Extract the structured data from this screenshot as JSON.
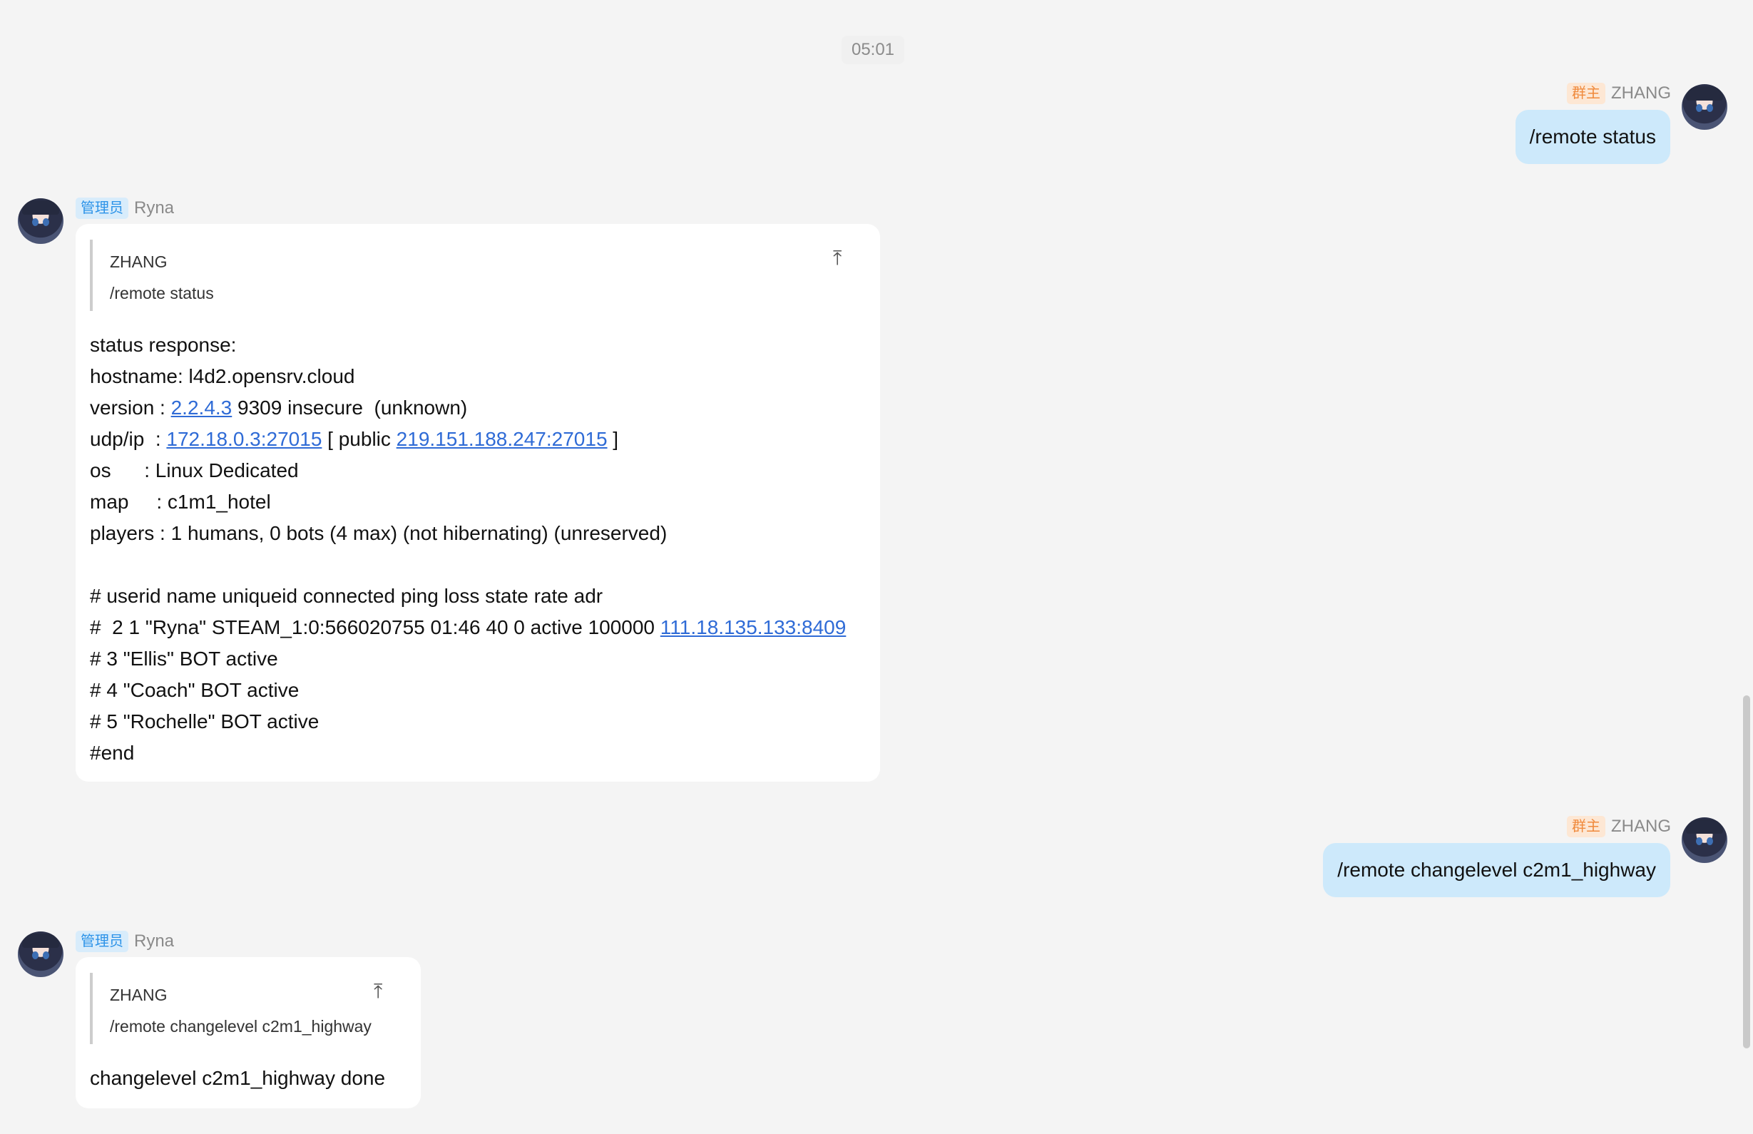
{
  "timestamp": "05:01",
  "messages": [
    {
      "side": "right",
      "badge": "群主",
      "sender": "ZHANG",
      "text": "/remote status"
    },
    {
      "side": "left",
      "badge": "管理员",
      "sender": "Ryna",
      "quote": {
        "author": "ZHANG",
        "text": "/remote status"
      },
      "lines": [
        [
          {
            "t": "status response:"
          }
        ],
        [
          {
            "t": "hostname: l4d2.opensrv.cloud"
          }
        ],
        [
          {
            "t": "version : "
          },
          {
            "t": "2.2.4.3",
            "link": true
          },
          {
            "t": " 9309 insecure  (unknown)"
          }
        ],
        [
          {
            "t": "udp/ip  : "
          },
          {
            "t": "172.18.0.3:27015",
            "link": true
          },
          {
            "t": " [ public "
          },
          {
            "t": "219.151.188.247:27015",
            "link": true
          },
          {
            "t": " ]"
          }
        ],
        [
          {
            "t": "os      : Linux Dedicated"
          }
        ],
        [
          {
            "t": "map     : c1m1_hotel"
          }
        ],
        [
          {
            "t": "players : 1 humans, 0 bots (4 max) (not hibernating) (unreserved)"
          }
        ],
        [
          {
            "t": ""
          }
        ],
        [
          {
            "t": "# userid name uniqueid connected ping loss state rate adr"
          }
        ],
        [
          {
            "t": "#  2 1 \"Ryna\" STEAM_1:0:566020755 01:46 40 0 active 100000 "
          },
          {
            "t": "111.18.135.133:8409",
            "link": true
          }
        ],
        [
          {
            "t": "# 3 \"Ellis\" BOT active"
          }
        ],
        [
          {
            "t": "# 4 \"Coach\" BOT active"
          }
        ],
        [
          {
            "t": "# 5 \"Rochelle\" BOT active"
          }
        ],
        [
          {
            "t": "#end"
          }
        ]
      ]
    },
    {
      "side": "right",
      "badge": "群主",
      "sender": "ZHANG",
      "text": "/remote changelevel c2m1_highway"
    },
    {
      "side": "left",
      "badge": "管理员",
      "sender": "Ryna",
      "quote": {
        "author": "ZHANG",
        "text": "/remote changelevel c2m1_highway"
      },
      "lines": [
        [
          {
            "t": "changelevel c2m1_highway done"
          }
        ]
      ]
    }
  ],
  "icons": {
    "quote_jump": "arrow-to-top-icon",
    "avatar": "anime-girl-avatar"
  },
  "colors": {
    "self_bubble": "#cde9fb",
    "link": "#2f6bd6",
    "owner_badge": "#f08a3c",
    "admin_badge": "#2c93e8"
  }
}
